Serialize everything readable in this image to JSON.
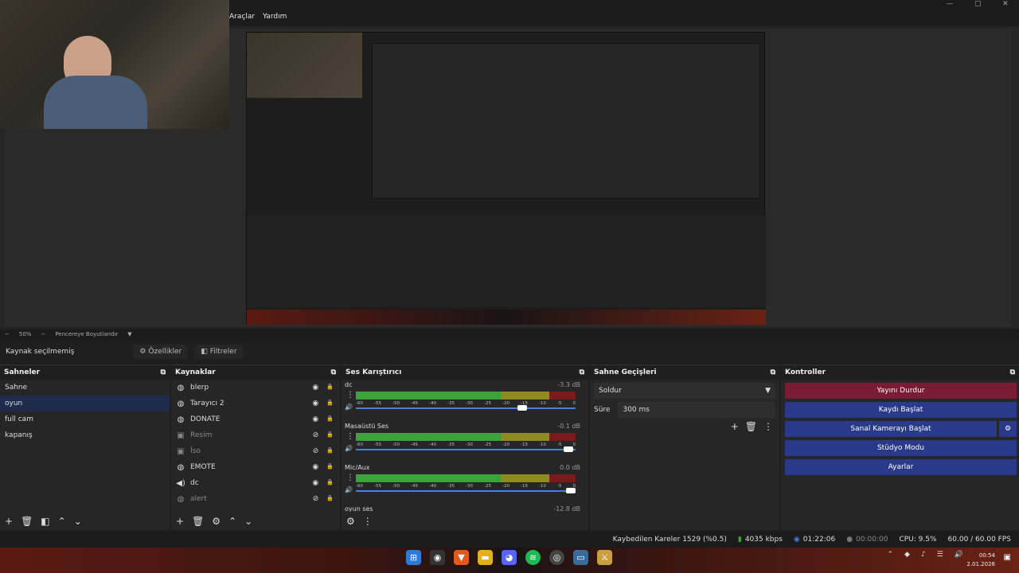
{
  "menu": {
    "items": [
      "Araçlar",
      "Yardım"
    ]
  },
  "window_controls": {
    "minimize": "—",
    "maximize": "▢",
    "close": "✕"
  },
  "zoom": {
    "minus": "−",
    "value": "50%",
    "plus": "−",
    "fit": "Pencereye Boyutlandır"
  },
  "source_toolbar": {
    "no_source": "Kaynak seçilmemiş",
    "properties": "Özellikler",
    "filters": "Filtreler"
  },
  "scenes": {
    "title": "Sahneler",
    "items": [
      "Sahne",
      "oyun",
      "full cam",
      "kapanış"
    ],
    "selected": "oyun"
  },
  "sources": {
    "title": "Kaynaklar",
    "items": [
      {
        "icon": "globe-icon",
        "label": "blerp",
        "hidden": false
      },
      {
        "icon": "globe-icon",
        "label": "Tarayıcı 2",
        "hidden": false
      },
      {
        "icon": "globe-icon",
        "label": "DONATE",
        "hidden": false
      },
      {
        "icon": "image-icon",
        "label": "Resim",
        "hidden": true
      },
      {
        "icon": "image-icon",
        "label": "İso",
        "hidden": true
      },
      {
        "icon": "globe-icon",
        "label": "EMOTE",
        "hidden": false
      },
      {
        "icon": "speaker-icon",
        "label": "dc",
        "hidden": false
      },
      {
        "icon": "globe-icon",
        "label": "alert",
        "hidden": true
      }
    ]
  },
  "mixer": {
    "title": "Ses Karıştırıcı",
    "ticks": [
      "-60",
      "-55",
      "-50",
      "-45",
      "-40",
      "-35",
      "-30",
      "-25",
      "-20",
      "-15",
      "-10",
      "-5",
      "0"
    ],
    "channels": [
      {
        "name": "dc",
        "db": "-3.3 dB",
        "level": 0.78
      },
      {
        "name": "Masaüstü Ses",
        "db": "-0.1 dB",
        "level": 0.99
      },
      {
        "name": "Mic/Aux",
        "db": "0.0 dB",
        "level": 1.0
      },
      {
        "name": "oyun ses",
        "db": "-12.8 dB",
        "level": 0.6
      }
    ]
  },
  "transitions": {
    "title": "Sahne Geçişleri",
    "type": "Soldur",
    "duration_label": "Süre",
    "duration": "300 ms"
  },
  "controls": {
    "title": "Kontroller",
    "stop_stream": "Yayını Durdur",
    "start_record": "Kaydı Başlat",
    "virtual_cam": "Sanal Kamerayı Başlat",
    "studio_mode": "Stüdyo Modu",
    "settings": "Ayarlar"
  },
  "status": {
    "dropped": "Kaybedilen Kareler 1529 (%0.5)",
    "bitrate": "4035 kbps",
    "stream_time": "01:22:06",
    "rec_time": "00:00:00",
    "cpu": "CPU: 9.5%",
    "fps": "60.00 / 60.00 FPS"
  },
  "clock": {
    "time": "00:54",
    "date": "2.01.2026"
  },
  "colors": {
    "accent_blue": "#2a3a8a",
    "accent_red": "#7a1c34",
    "selection": "#1e2b4a"
  }
}
